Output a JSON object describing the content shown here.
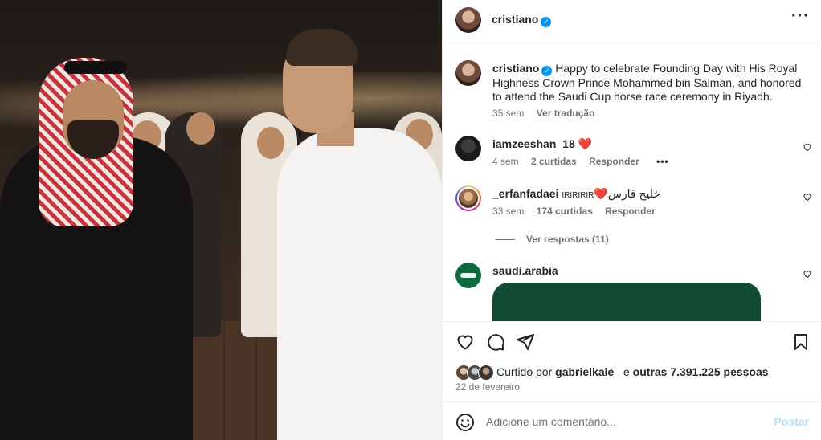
{
  "header": {
    "username": "cristiano",
    "verified_icon": "verified-badge-icon",
    "more_icon": "more-options-icon"
  },
  "caption": {
    "username": "cristiano",
    "text": "Happy to celebrate Founding Day with His Royal Highness Crown Prince Mohammed bin Salman, and honored to attend the Saudi Cup horse race ceremony in Riyadh.",
    "time": "35 sem",
    "translate": "Ver tradução"
  },
  "comments": [
    {
      "username": "iamzeeshan_18",
      "text": "",
      "emoji": "❤️",
      "time": "4 sem",
      "likes": "2 curtidas",
      "reply": "Responder",
      "more": "•••"
    },
    {
      "username": "_erfanfadaei",
      "text": "خلیج فارس",
      "small_text": "IRIRIRIR",
      "emoji": "❤️",
      "time": "33 sem",
      "likes": "174 curtidas",
      "reply": "Responder",
      "view_replies": "Ver respostas (11)"
    },
    {
      "username": "saudi.arabia",
      "text": ""
    }
  ],
  "actions": {
    "like_icon": "heart-icon",
    "comment_icon": "comment-icon",
    "share_icon": "share-icon",
    "save_icon": "bookmark-icon"
  },
  "likes": {
    "prefix": "Curtido por",
    "user": "gabrielkale_",
    "middle": "e",
    "others": "outras 7.391.225 pessoas"
  },
  "date": "22 de fevereiro",
  "add_comment": {
    "placeholder": "Adicione um comentário...",
    "post_label": "Postar",
    "emoji_icon": "emoji-icon"
  },
  "colors": {
    "verified": "#0095f6",
    "heart": "#ed4956",
    "post_disabled": "#b2dffc",
    "muted": "#737373"
  }
}
